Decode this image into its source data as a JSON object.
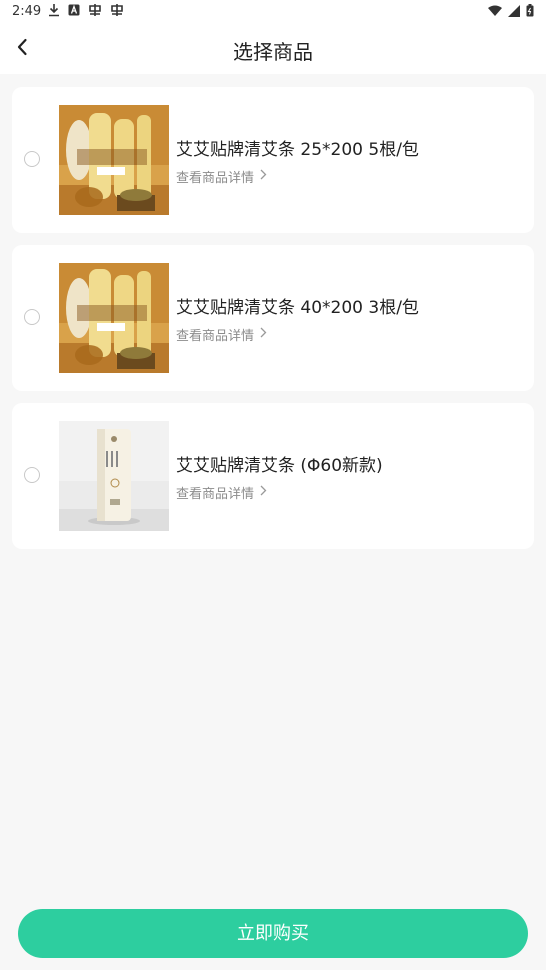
{
  "status_bar": {
    "time": "2:49",
    "left_icons": [
      "download-icon",
      "a-badge-icon",
      "app-icon",
      "app-icon"
    ],
    "right_icons": [
      "wifi-icon",
      "signal-icon",
      "battery-icon"
    ]
  },
  "header": {
    "title": "选择商品",
    "back_icon": "chevron-left-icon"
  },
  "products": [
    {
      "name": "艾艾贴牌清艾条 25*200 5根/包",
      "detail_label": "查看商品详情",
      "selected": false,
      "image": "moxa-sticks-warm"
    },
    {
      "name": "艾艾贴牌清艾条 40*200 3根/包",
      "detail_label": "查看商品详情",
      "selected": false,
      "image": "moxa-sticks-warm"
    },
    {
      "name": "艾艾贴牌清艾条 (Φ60新款)",
      "detail_label": "查看商品详情",
      "selected": false,
      "image": "moxa-tube-white"
    }
  ],
  "footer": {
    "buy_label": "立即购买"
  },
  "colors": {
    "accent": "#2dce9f",
    "background": "#f7f7f7",
    "card": "#ffffff",
    "secondary_text": "#8c8c8c"
  }
}
